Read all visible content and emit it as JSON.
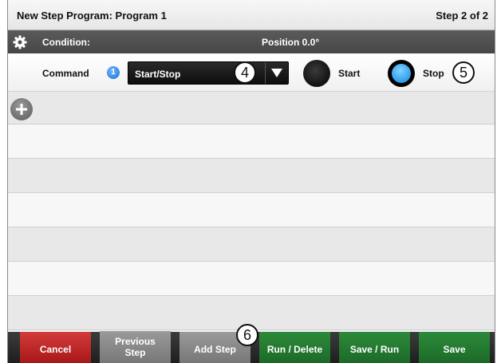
{
  "titlebar": {
    "title": "New Step Program:  Program 1",
    "step": "Step 2 of 2"
  },
  "condition_bar": {
    "icon": "gear-icon",
    "label": "Condition:",
    "position": "Position 0.0°"
  },
  "command_row": {
    "label": "Command",
    "info_badge": "1",
    "dropdown_value": "Start/Stop",
    "radio_start_label": "Start",
    "radio_stop_label": "Stop",
    "selected_option": "Stop",
    "accent_color": "#0d88de"
  },
  "callouts": {
    "dropdown": "4",
    "stop": "5",
    "add_step": "6"
  },
  "add_button_icon": "plus-icon",
  "footer": {
    "cancel": "Cancel",
    "previous_line1": "Previous",
    "previous_line2": "Step",
    "add_step": "Add Step",
    "run_delete": "Run / Delete",
    "save_run": "Save / Run",
    "save": "Save"
  }
}
